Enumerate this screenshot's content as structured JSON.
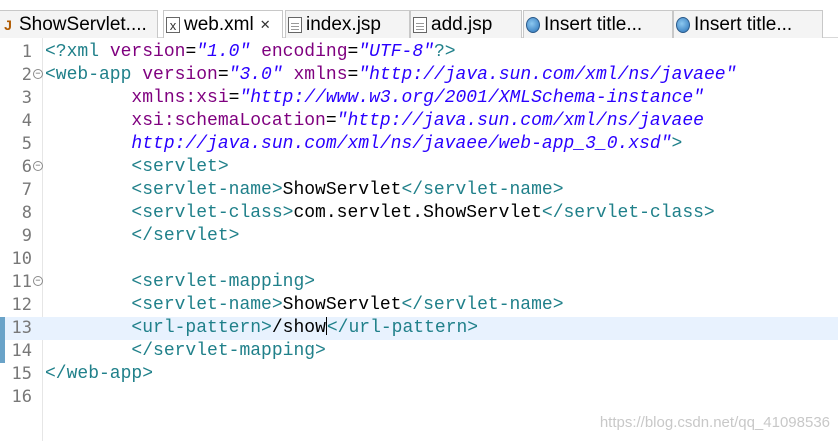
{
  "tabs": [
    {
      "label": "ShowServlet....",
      "icon": "java-file-icon",
      "active": false
    },
    {
      "label": "web.xml",
      "icon": "xml-file-icon",
      "active": true
    },
    {
      "label": "index.jsp",
      "icon": "jsp-file-icon",
      "active": false
    },
    {
      "label": "add.jsp",
      "icon": "jsp-file-icon",
      "active": false
    },
    {
      "label": "Insert title...",
      "icon": "globe-icon",
      "active": false
    },
    {
      "label": "Insert title...",
      "icon": "globe-icon",
      "active": false
    }
  ],
  "editor": {
    "current_line": 13,
    "lines": [
      {
        "n": "1",
        "fold": false,
        "tokens": [
          [
            "tag",
            "<?xml "
          ],
          [
            "attr",
            "version"
          ],
          [
            "eq",
            "="
          ],
          [
            "val",
            "\"1.0\""
          ],
          [
            "t",
            " "
          ],
          [
            "attr",
            "encoding"
          ],
          [
            "eq",
            "="
          ],
          [
            "val",
            "\"UTF-8\""
          ],
          [
            "tag",
            "?>"
          ]
        ]
      },
      {
        "n": "2",
        "fold": true,
        "tokens": [
          [
            "tag",
            "<web-app "
          ],
          [
            "attr",
            "version"
          ],
          [
            "eq",
            "="
          ],
          [
            "val",
            "\"3.0\""
          ],
          [
            "t",
            " "
          ],
          [
            "attr",
            "xmlns"
          ],
          [
            "eq",
            "="
          ],
          [
            "val",
            "\"http://java.sun.com/xml/ns/javaee\""
          ]
        ]
      },
      {
        "n": "3",
        "fold": false,
        "tokens": [
          [
            "t",
            "        "
          ],
          [
            "attr",
            "xmlns:xsi"
          ],
          [
            "eq",
            "="
          ],
          [
            "val",
            "\"http://www.w3.org/2001/XMLSchema-instance\""
          ]
        ]
      },
      {
        "n": "4",
        "fold": false,
        "tokens": [
          [
            "t",
            "        "
          ],
          [
            "attr",
            "xsi:schemaLocation"
          ],
          [
            "eq",
            "="
          ],
          [
            "val",
            "\"http://java.sun.com/xml/ns/javaee"
          ]
        ]
      },
      {
        "n": "5",
        "fold": false,
        "tokens": [
          [
            "t",
            "        "
          ],
          [
            "val",
            "http://java.sun.com/xml/ns/javaee/web-app_3_0.xsd\""
          ],
          [
            "tag",
            ">"
          ]
        ]
      },
      {
        "n": "6",
        "fold": true,
        "tokens": [
          [
            "t",
            "        "
          ],
          [
            "tag",
            "<servlet>"
          ]
        ]
      },
      {
        "n": "7",
        "fold": false,
        "tokens": [
          [
            "t",
            "        "
          ],
          [
            "tag",
            "<servlet-name>"
          ],
          [
            "t",
            "ShowServlet"
          ],
          [
            "tag",
            "</servlet-name>"
          ]
        ]
      },
      {
        "n": "8",
        "fold": false,
        "tokens": [
          [
            "t",
            "        "
          ],
          [
            "tag",
            "<servlet-class>"
          ],
          [
            "t",
            "com.servlet.ShowServlet"
          ],
          [
            "tag",
            "</servlet-class>"
          ]
        ]
      },
      {
        "n": "9",
        "fold": false,
        "tokens": [
          [
            "t",
            "        "
          ],
          [
            "tag",
            "</servlet>"
          ]
        ]
      },
      {
        "n": "10",
        "fold": false,
        "tokens": []
      },
      {
        "n": "11",
        "fold": true,
        "tokens": [
          [
            "t",
            "        "
          ],
          [
            "tag",
            "<servlet-mapping>"
          ]
        ]
      },
      {
        "n": "12",
        "fold": false,
        "tokens": [
          [
            "t",
            "        "
          ],
          [
            "tag",
            "<servlet-name>"
          ],
          [
            "t",
            "ShowServlet"
          ],
          [
            "tag",
            "</servlet-name>"
          ]
        ]
      },
      {
        "n": "13",
        "fold": false,
        "tokens": [
          [
            "t",
            "        "
          ],
          [
            "tag",
            "<url-pattern>"
          ],
          [
            "t",
            "/show"
          ],
          [
            "caret",
            ""
          ],
          [
            "tag",
            "</url-pattern>"
          ]
        ]
      },
      {
        "n": "14",
        "fold": false,
        "tokens": [
          [
            "t",
            "        "
          ],
          [
            "tag",
            "</servlet-mapping>"
          ]
        ]
      },
      {
        "n": "15",
        "fold": false,
        "tokens": [
          [
            "tag",
            "</web-app>"
          ]
        ]
      },
      {
        "n": "16",
        "fold": false,
        "tokens": []
      }
    ]
  },
  "watermark": "https://blog.csdn.net/qq_41098536",
  "colors": {
    "tag": "#20808a",
    "attr": "#7f007f",
    "value": "#2a00ff",
    "current_line": "#e8f2fe"
  }
}
